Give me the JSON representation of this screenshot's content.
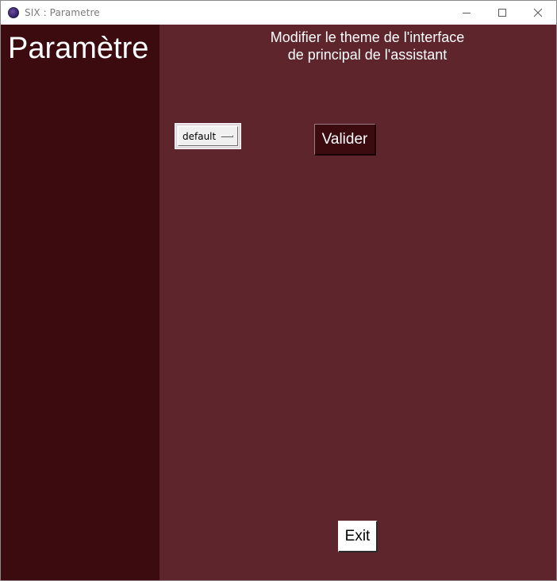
{
  "window": {
    "title": "SIX : Parametre",
    "icon": "app-globe-icon",
    "controls": {
      "minimize": "minimize-icon",
      "maximize": "maximize-icon",
      "close": "close-icon"
    }
  },
  "sidebar": {
    "title": "Paramètre"
  },
  "main": {
    "heading_line1": "Modifier le theme de l'interface",
    "heading_line2": "de principal de l'assistant",
    "theme_select": {
      "value": "default"
    },
    "validate_label": "Valider",
    "exit_label": "Exit"
  },
  "colors": {
    "sidebar_bg": "#3b0b10",
    "main_bg": "#5e252d",
    "text": "#ffffff"
  }
}
